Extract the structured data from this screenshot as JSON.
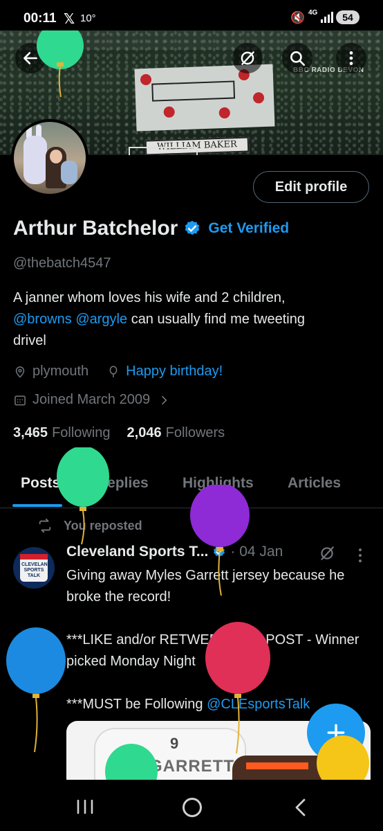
{
  "status_bar": {
    "time": "00:11",
    "x_symbol": "𝕏",
    "temperature": "10°",
    "network": "4G",
    "battery": "54"
  },
  "banner": {
    "name_sign": "WILLIAM BAKER",
    "tag": "BBC RADIO DEVON"
  },
  "profile": {
    "edit_label": "Edit profile",
    "name": "Arthur Batchelor",
    "get_verified": "Get Verified",
    "handle": "@thebatch4547",
    "bio_1": "A janner whom loves his wife and 2 children,",
    "bio_link1": "@browns",
    "bio_link2": "@argyle",
    "bio_2": "can usually find me tweeting",
    "bio_3": "drivel",
    "location": "plymouth",
    "birthday": "Happy birthday!",
    "joined": "Joined March 2009",
    "following_count": "3,465",
    "following_label": "Following",
    "followers_count": "2,046",
    "followers_label": "Followers"
  },
  "tabs": {
    "posts": "Posts",
    "replies": "Replies",
    "highlights": "Highlights",
    "articles": "Articles"
  },
  "post": {
    "repost_label": "You reposted",
    "author": "Cleveland Sports T...",
    "date": "· 04 Jan",
    "avatar_text": "CLEVELAND SPORTS TALK",
    "line1": "Giving away Myles Garrett jersey because he broke the record!",
    "line2": "***LIKE and/or RETWEET THIS POST - Winner picked Monday Night",
    "line3_prefix": "***MUST be Following",
    "line3_link": "@CLEsportsTalk",
    "jersey_name": "GARRETT"
  },
  "colors": {
    "accent": "#1d9bf0",
    "background": "#000000",
    "text_primary": "#e7e9ea",
    "text_secondary": "#71767b",
    "balloon_green": "#2fd98f",
    "balloon_purple": "#8e2ad6",
    "balloon_blue": "#1c8ae0",
    "balloon_red": "#e03058",
    "balloon_yellow": "#f5c518"
  }
}
